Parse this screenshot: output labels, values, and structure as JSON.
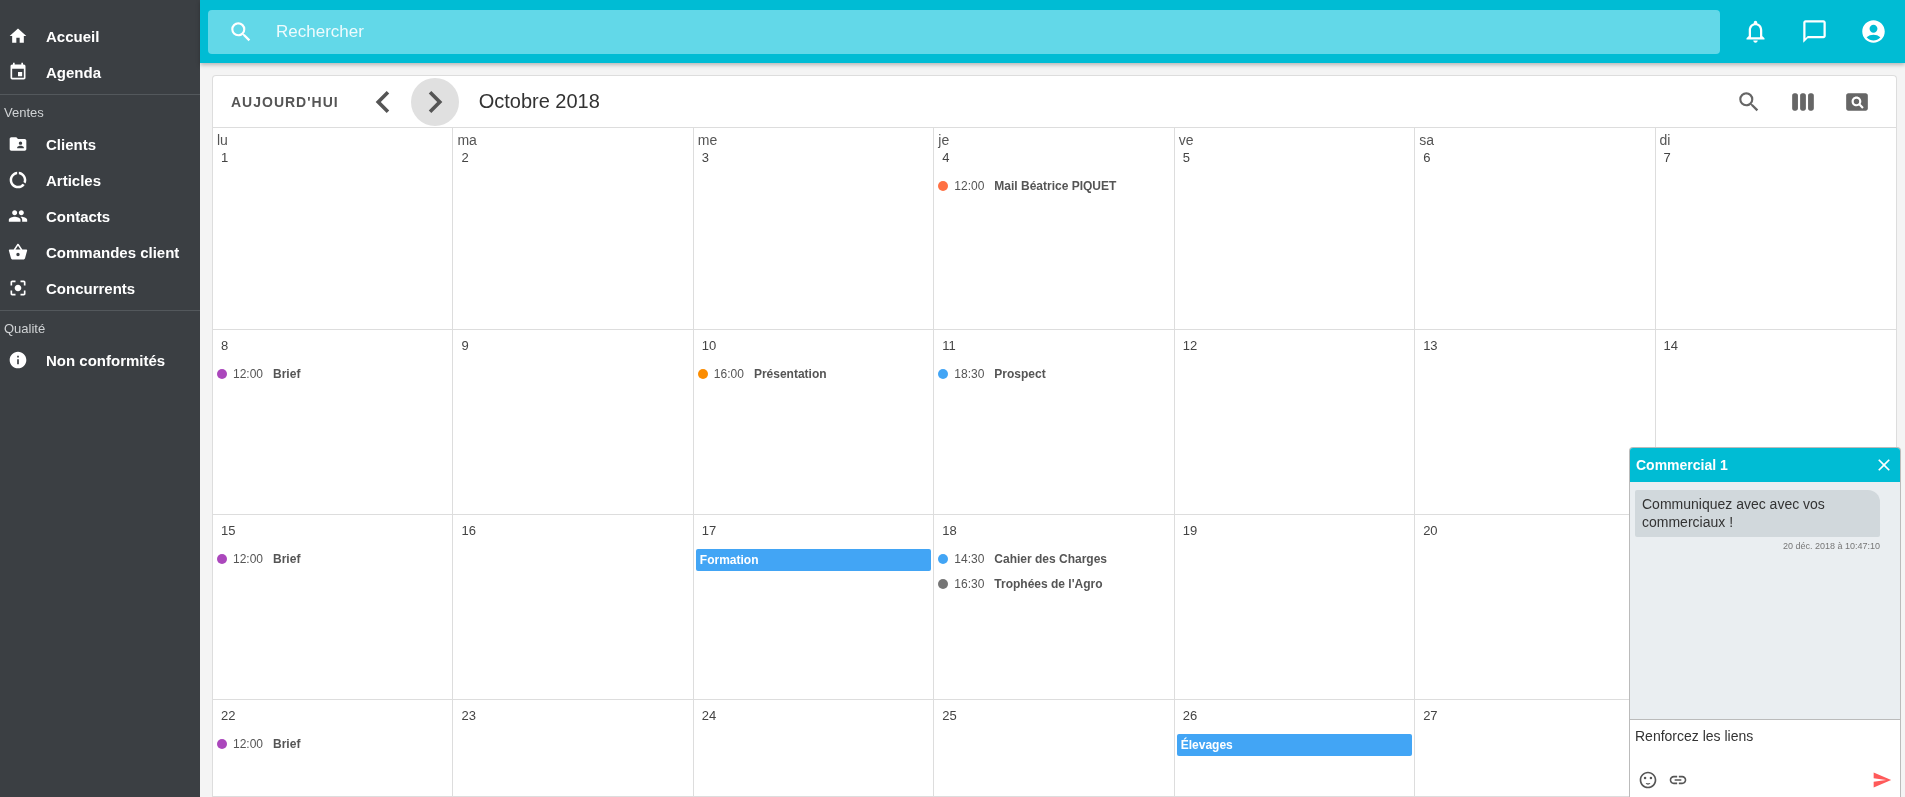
{
  "sidebar": {
    "sections": [
      {
        "items": [
          {
            "label": "Accueil"
          },
          {
            "label": "Agenda"
          }
        ]
      },
      {
        "title": "Ventes",
        "items": [
          {
            "label": "Clients"
          },
          {
            "label": "Articles"
          },
          {
            "label": "Contacts"
          },
          {
            "label": "Commandes client"
          },
          {
            "label": "Concurrents"
          }
        ]
      },
      {
        "title": "Qualité",
        "items": [
          {
            "label": "Non conformités"
          }
        ]
      }
    ]
  },
  "topbar": {
    "search": {
      "placeholder": "Rechercher"
    }
  },
  "calendar": {
    "today_button": "AUJOURD'HUI",
    "title": "Octobre 2018",
    "weekdays": [
      "lu",
      "ma",
      "me",
      "je",
      "ve",
      "sa",
      "di"
    ],
    "weeks": [
      {
        "days": [
          {
            "day": "1"
          },
          {
            "day": "2"
          },
          {
            "day": "3"
          },
          {
            "day": "4",
            "events": [
              {
                "kind": "dot",
                "time": "12:00",
                "title": "Mail Béatrice PIQUET",
                "color": "#ff7043"
              }
            ]
          },
          {
            "day": "5"
          },
          {
            "day": "6"
          },
          {
            "day": "7"
          }
        ]
      },
      {
        "days": [
          {
            "day": "8",
            "events": [
              {
                "kind": "dot",
                "time": "12:00",
                "title": "Brief",
                "color": "#ab47bc"
              }
            ]
          },
          {
            "day": "9"
          },
          {
            "day": "10",
            "events": [
              {
                "kind": "dot",
                "time": "16:00",
                "title": "Présentation",
                "color": "#fb8c00"
              }
            ]
          },
          {
            "day": "11",
            "events": [
              {
                "kind": "dot",
                "time": "18:30",
                "title": "Prospect",
                "color": "#42a5f5"
              }
            ]
          },
          {
            "day": "12"
          },
          {
            "day": "13"
          },
          {
            "day": "14"
          }
        ]
      },
      {
        "days": [
          {
            "day": "15",
            "events": [
              {
                "kind": "dot",
                "time": "12:00",
                "title": "Brief",
                "color": "#ab47bc"
              }
            ]
          },
          {
            "day": "16"
          },
          {
            "day": "17",
            "events": [
              {
                "kind": "bar",
                "title": "Formation",
                "color": "#42a5f5"
              }
            ]
          },
          {
            "day": "18",
            "events": [
              {
                "kind": "dot",
                "time": "14:30",
                "title": "Cahier des Charges",
                "color": "#42a5f5"
              },
              {
                "kind": "dot",
                "time": "16:30",
                "title": "Trophées de l'Agro",
                "color": "#757575"
              }
            ]
          },
          {
            "day": "19"
          },
          {
            "day": "20"
          }
        ]
      },
      {
        "days": [
          {
            "day": "22",
            "events": [
              {
                "kind": "dot",
                "time": "12:00",
                "title": "Brief",
                "color": "#ab47bc"
              }
            ]
          },
          {
            "day": "23"
          },
          {
            "day": "24"
          },
          {
            "day": "25"
          },
          {
            "day": "26",
            "events": [
              {
                "kind": "bar",
                "title": "Élevages",
                "color": "#42a5f5"
              }
            ]
          },
          {
            "day": "27"
          }
        ]
      }
    ]
  },
  "chat": {
    "title": "Commercial 1",
    "messages": [
      {
        "text": "Communiquez avec avec vos commerciaux !",
        "time": "20 déc. 2018 à 10:47:10"
      }
    ],
    "input": {
      "value": "Renforcez les liens"
    }
  }
}
